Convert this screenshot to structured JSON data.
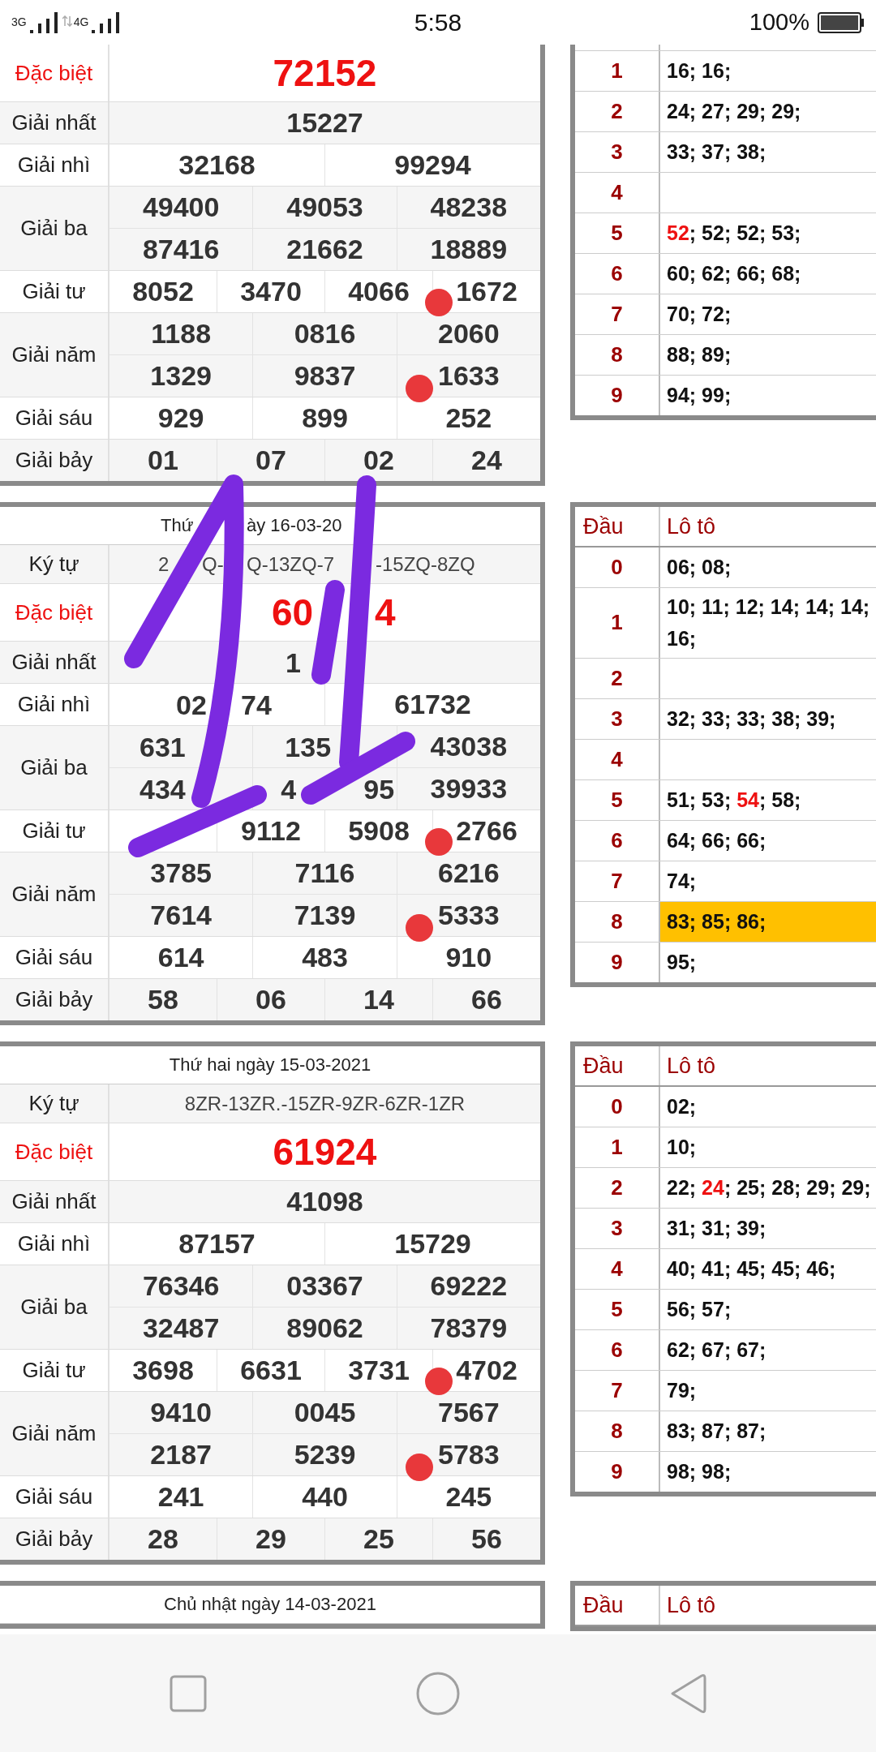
{
  "status_bar": {
    "network_1": "3G",
    "network_2": "4G",
    "time": "5:58",
    "battery": "100%"
  },
  "draws": [
    {
      "prizes": [
        {
          "label": "Đặc biệt",
          "kind": "special",
          "rows": [
            [
              "72152"
            ]
          ]
        },
        {
          "label": "Giải nhất",
          "kind": "normal",
          "rows": [
            [
              "15227"
            ]
          ]
        },
        {
          "label": "Giải nhì",
          "kind": "normal",
          "rows": [
            [
              "32168",
              "99294"
            ]
          ]
        },
        {
          "label": "Giải ba",
          "kind": "normal",
          "rows": [
            [
              "49400",
              "49053",
              "48238"
            ],
            [
              "87416",
              "21662",
              "18889"
            ]
          ]
        },
        {
          "label": "Giải tư",
          "kind": "normal",
          "rows": [
            [
              "8052",
              "3470",
              "4066",
              {
                "text": "1672",
                "dot": true
              }
            ]
          ]
        },
        {
          "label": "Giải năm",
          "kind": "normal",
          "rows": [
            [
              "1188",
              "0816",
              "2060"
            ],
            [
              "1329",
              "9837",
              {
                "text": "1633",
                "dot": true
              }
            ]
          ]
        },
        {
          "label": "Giải sáu",
          "kind": "normal",
          "rows": [
            [
              "929",
              "899",
              "252"
            ]
          ]
        },
        {
          "label": "Giải bảy",
          "kind": "normal",
          "rows": [
            [
              "01",
              "07",
              "02",
              "24"
            ]
          ]
        }
      ],
      "loto": {
        "rows": [
          {
            "head": "1",
            "highlighted": false,
            "segments": [
              {
                "text": "16; 16;",
                "red": false
              }
            ]
          },
          {
            "head": "2",
            "highlighted": false,
            "segments": [
              {
                "text": "24; 27; 29; 29;",
                "red": false
              }
            ]
          },
          {
            "head": "3",
            "highlighted": false,
            "segments": [
              {
                "text": "33; 37; 38;",
                "red": false
              }
            ]
          },
          {
            "head": "4",
            "highlighted": false,
            "segments": []
          },
          {
            "head": "5",
            "highlighted": false,
            "segments": [
              {
                "text": "52",
                "red": true
              },
              {
                "text": "; 52; 52; 53;",
                "red": false
              }
            ]
          },
          {
            "head": "6",
            "highlighted": false,
            "segments": [
              {
                "text": "60; 62; 66; 68;",
                "red": false
              }
            ]
          },
          {
            "head": "7",
            "highlighted": false,
            "segments": [
              {
                "text": "70; 72;",
                "red": false
              }
            ]
          },
          {
            "head": "8",
            "highlighted": false,
            "segments": [
              {
                "text": "88; 89;",
                "red": false
              }
            ]
          },
          {
            "head": "9",
            "highlighted": false,
            "segments": [
              {
                "text": "94; 99;",
                "red": false
              }
            ]
          }
        ]
      }
    },
    {
      "date": {
        "parts": [
          "Thứ",
          "ày 16-03-20"
        ]
      },
      "prizes": [
        {
          "label": "Ký tự",
          "kind": "code",
          "rows": [
            [
              {
                "parts": [
                  "2",
                  "Q-",
                  "Q-13ZQ-7",
                  "-15ZQ-8ZQ"
                ]
              }
            ]
          ]
        },
        {
          "label": "Đặc biệt",
          "kind": "special",
          "rows": [
            [
              {
                "parts": [
                  "60",
                  "4"
                ]
              }
            ]
          ]
        },
        {
          "label": "Giải nhất",
          "kind": "normal",
          "rows": [
            [
              {
                "parts": [
                  "1"
                ]
              }
            ]
          ]
        },
        {
          "label": "Giải nhì",
          "kind": "normal",
          "rows": [
            [
              {
                "parts": [
                  "02",
                  "74"
                ]
              },
              "61732"
            ]
          ]
        },
        {
          "label": "Giải ba",
          "kind": "normal",
          "rows": [
            [
              {
                "parts": [
                  "631"
                ]
              },
              {
                "parts": [
                  "135"
                ]
              },
              "43038"
            ],
            [
              {
                "parts": [
                  "434"
                ]
              },
              {
                "parts": [
                  "4",
                  "95"
                ]
              },
              "39933"
            ]
          ]
        },
        {
          "label": "Giải tư",
          "kind": "normal",
          "rows": [
            [
              {},
              "9112",
              "5908",
              {
                "text": "2766",
                "dot": true
              }
            ]
          ]
        },
        {
          "label": "Giải năm",
          "kind": "normal",
          "rows": [
            [
              "3785",
              "7116",
              "6216"
            ],
            [
              "7614",
              "7139",
              {
                "text": "5333",
                "dot": true
              }
            ]
          ]
        },
        {
          "label": "Giải sáu",
          "kind": "normal",
          "rows": [
            [
              "614",
              "483",
              "910"
            ]
          ]
        },
        {
          "label": "Giải bảy",
          "kind": "normal",
          "rows": [
            [
              "58",
              "06",
              "14",
              "66"
            ]
          ]
        }
      ],
      "loto": {
        "head_label": "Đầu",
        "values_label": "Lô tô",
        "rows": [
          {
            "head": "0",
            "highlighted": false,
            "segments": [
              {
                "text": "06; 08;",
                "red": false
              }
            ]
          },
          {
            "head": "1",
            "highlighted": false,
            "segments": [
              {
                "text": "10; 11; 12; 14; 14; 14; 16;",
                "red": false
              }
            ]
          },
          {
            "head": "2",
            "highlighted": false,
            "segments": []
          },
          {
            "head": "3",
            "highlighted": false,
            "segments": [
              {
                "text": "32; 33; 33; 38; 39;",
                "red": false
              }
            ]
          },
          {
            "head": "4",
            "highlighted": false,
            "segments": []
          },
          {
            "head": "5",
            "highlighted": false,
            "segments": [
              {
                "text": "51; 53; ",
                "red": false
              },
              {
                "text": "54",
                "red": true
              },
              {
                "text": "; 58;",
                "red": false
              }
            ]
          },
          {
            "head": "6",
            "highlighted": false,
            "segments": [
              {
                "text": "64; 66; 66;",
                "red": false
              }
            ]
          },
          {
            "head": "7",
            "highlighted": false,
            "segments": [
              {
                "text": "74;",
                "red": false
              }
            ]
          },
          {
            "head": "8",
            "highlighted": true,
            "segments": [
              {
                "text": "83; 85; 86;",
                "red": false
              }
            ]
          },
          {
            "head": "9",
            "highlighted": false,
            "segments": [
              {
                "text": "95;",
                "red": false
              }
            ]
          }
        ]
      }
    },
    {
      "date": "Thứ hai ngày 15-03-2021",
      "prizes": [
        {
          "label": "Ký tự",
          "kind": "code",
          "rows": [
            [
              "8ZR-13ZR.-15ZR-9ZR-6ZR-1ZR"
            ]
          ]
        },
        {
          "label": "Đặc biệt",
          "kind": "special",
          "rows": [
            [
              "61924"
            ]
          ]
        },
        {
          "label": "Giải nhất",
          "kind": "normal",
          "rows": [
            [
              "41098"
            ]
          ]
        },
        {
          "label": "Giải nhì",
          "kind": "normal",
          "rows": [
            [
              "87157",
              "15729"
            ]
          ]
        },
        {
          "label": "Giải ba",
          "kind": "normal",
          "rows": [
            [
              "76346",
              "03367",
              "69222"
            ],
            [
              "32487",
              "89062",
              "78379"
            ]
          ]
        },
        {
          "label": "Giải tư",
          "kind": "normal",
          "rows": [
            [
              "3698",
              "6631",
              "3731",
              {
                "text": "4702",
                "dot": true
              }
            ]
          ]
        },
        {
          "label": "Giải năm",
          "kind": "normal",
          "rows": [
            [
              "9410",
              "0045",
              "7567"
            ],
            [
              "2187",
              "5239",
              {
                "text": "5783",
                "dot": true
              }
            ]
          ]
        },
        {
          "label": "Giải sáu",
          "kind": "normal",
          "rows": [
            [
              "241",
              "440",
              "245"
            ]
          ]
        },
        {
          "label": "Giải bảy",
          "kind": "normal",
          "rows": [
            [
              "28",
              "29",
              "25",
              "56"
            ]
          ]
        }
      ],
      "loto": {
        "head_label": "Đầu",
        "values_label": "Lô tô",
        "rows": [
          {
            "head": "0",
            "highlighted": false,
            "segments": [
              {
                "text": "02;",
                "red": false
              }
            ]
          },
          {
            "head": "1",
            "highlighted": false,
            "segments": [
              {
                "text": "10;",
                "red": false
              }
            ]
          },
          {
            "head": "2",
            "highlighted": false,
            "segments": [
              {
                "text": "22; ",
                "red": false
              },
              {
                "text": "24",
                "red": true
              },
              {
                "text": "; 25; 28; 29; 29;",
                "red": false
              }
            ]
          },
          {
            "head": "3",
            "highlighted": false,
            "segments": [
              {
                "text": "31; 31; 39;",
                "red": false
              }
            ]
          },
          {
            "head": "4",
            "highlighted": false,
            "segments": [
              {
                "text": "40; 41; 45; 45; 46;",
                "red": false
              }
            ]
          },
          {
            "head": "5",
            "highlighted": false,
            "segments": [
              {
                "text": "56; 57;",
                "red": false
              }
            ]
          },
          {
            "head": "6",
            "highlighted": false,
            "segments": [
              {
                "text": "62; 67; 67;",
                "red": false
              }
            ]
          },
          {
            "head": "7",
            "highlighted": false,
            "segments": [
              {
                "text": "79;",
                "red": false
              }
            ]
          },
          {
            "head": "8",
            "highlighted": false,
            "segments": [
              {
                "text": "83; 87; 87;",
                "red": false
              }
            ]
          },
          {
            "head": "9",
            "highlighted": false,
            "segments": [
              {
                "text": "98; 98;",
                "red": false
              }
            ]
          }
        ]
      }
    },
    {
      "date": "Chủ nhật ngày 14-03-2021",
      "loto": {
        "head_label": "Đầu",
        "values_label": "Lô tô"
      }
    }
  ]
}
